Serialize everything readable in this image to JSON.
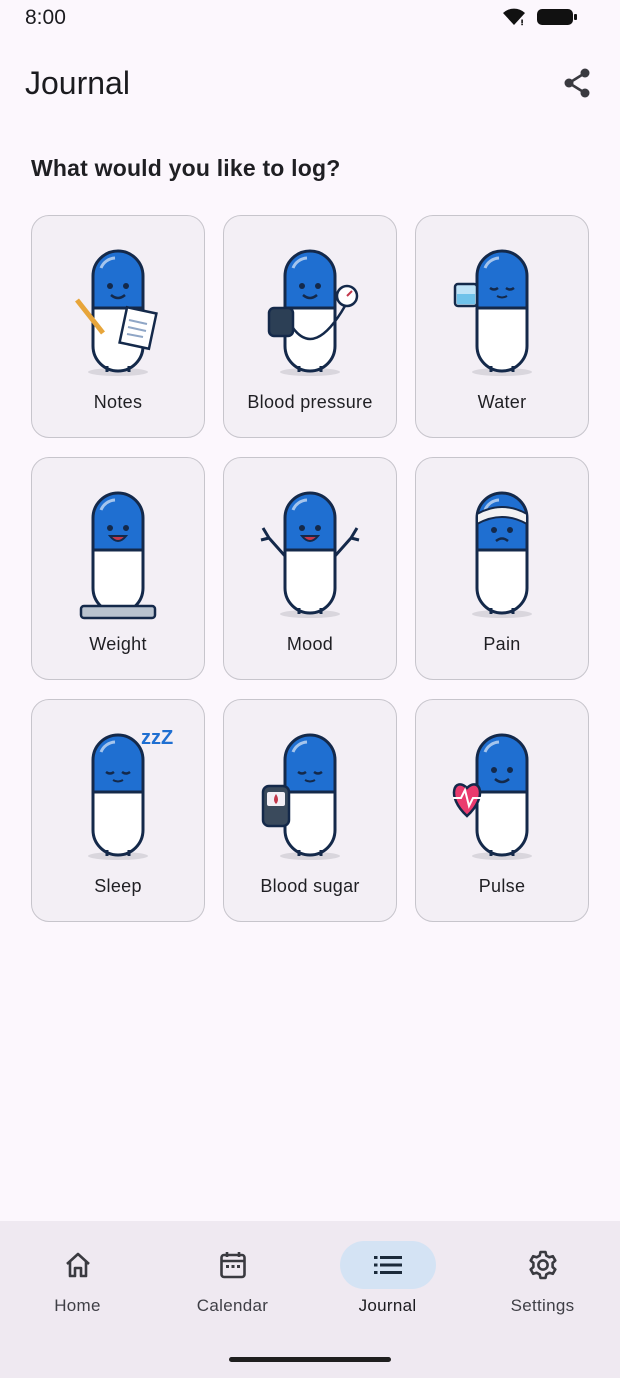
{
  "status_bar": {
    "time": "8:00",
    "wifi_icon": "wifi-icon",
    "battery_icon": "battery-icon"
  },
  "app_bar": {
    "title": "Journal",
    "share_icon": "share-icon"
  },
  "prompt": "What would you like to log?",
  "tiles": [
    {
      "label": "Notes",
      "icon": "notes-pill-icon"
    },
    {
      "label": "Blood pressure",
      "icon": "blood-pressure-pill-icon"
    },
    {
      "label": "Water",
      "icon": "water-pill-icon"
    },
    {
      "label": "Weight",
      "icon": "weight-pill-icon"
    },
    {
      "label": "Mood",
      "icon": "mood-pill-icon"
    },
    {
      "label": "Pain",
      "icon": "pain-pill-icon"
    },
    {
      "label": "Sleep",
      "icon": "sleep-pill-icon"
    },
    {
      "label": "Blood sugar",
      "icon": "blood-sugar-pill-icon"
    },
    {
      "label": "Pulse",
      "icon": "pulse-pill-icon"
    }
  ],
  "bottom_nav": {
    "items": [
      {
        "label": "Home",
        "icon": "home-icon",
        "active": false
      },
      {
        "label": "Calendar",
        "icon": "calendar-icon",
        "active": false
      },
      {
        "label": "Journal",
        "icon": "list-icon",
        "active": true
      },
      {
        "label": "Settings",
        "icon": "gear-icon",
        "active": false
      }
    ]
  },
  "colors": {
    "accent_blue": "#1f6fd1",
    "active_pill": "#d4e3f4",
    "background": "#fcf7fd",
    "tile_bg": "#f3eff5"
  }
}
